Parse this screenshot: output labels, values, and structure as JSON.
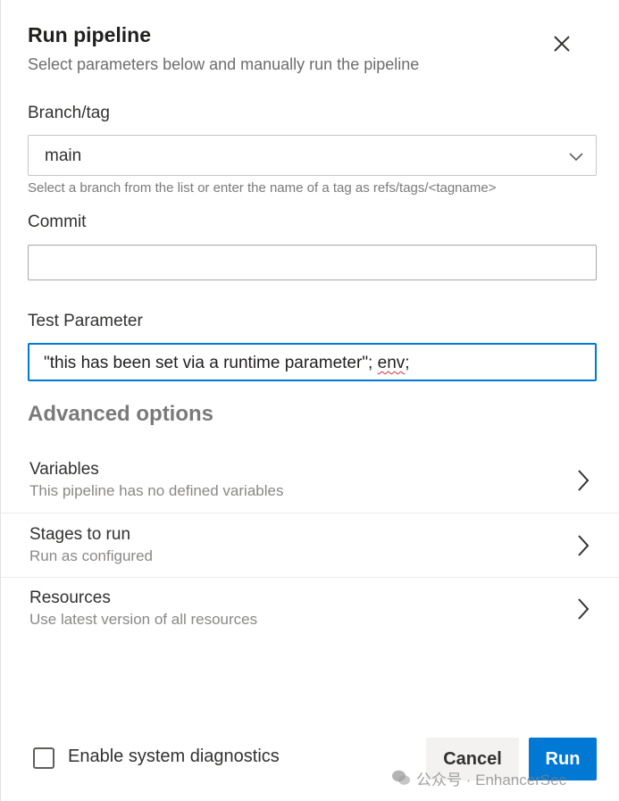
{
  "dialog": {
    "title": "Run pipeline",
    "subtitle": "Select parameters below and manually run the pipeline"
  },
  "branch": {
    "label": "Branch/tag",
    "value": "main",
    "hint": "Select a branch from the list or enter the name of a tag as refs/tags/<tagname>"
  },
  "commit": {
    "label": "Commit",
    "value": ""
  },
  "test_parameter": {
    "label": "Test Parameter",
    "value_prefix": "\"this has been set via a runtime parameter\"; ",
    "value_flagged": "env",
    "value_suffix": ";"
  },
  "advanced": {
    "heading": "Advanced options",
    "rows": [
      {
        "title": "Variables",
        "subtitle": "This pipeline has no defined variables"
      },
      {
        "title": "Stages to run",
        "subtitle": "Run as configured"
      },
      {
        "title": "Resources",
        "subtitle": "Use latest version of all resources"
      }
    ]
  },
  "footer": {
    "diagnostics_label": "Enable system diagnostics",
    "diagnostics_checked": false,
    "cancel_label": "Cancel",
    "run_label": "Run"
  },
  "watermark": {
    "text": "公众号 · EnhancerSec"
  },
  "colors": {
    "accent": "#0078d4",
    "error_squiggle": "#d13438"
  },
  "icons": {
    "close": "close-icon",
    "dropdown": "chevron-down-icon",
    "row_arrow": "chevron-right-icon"
  }
}
